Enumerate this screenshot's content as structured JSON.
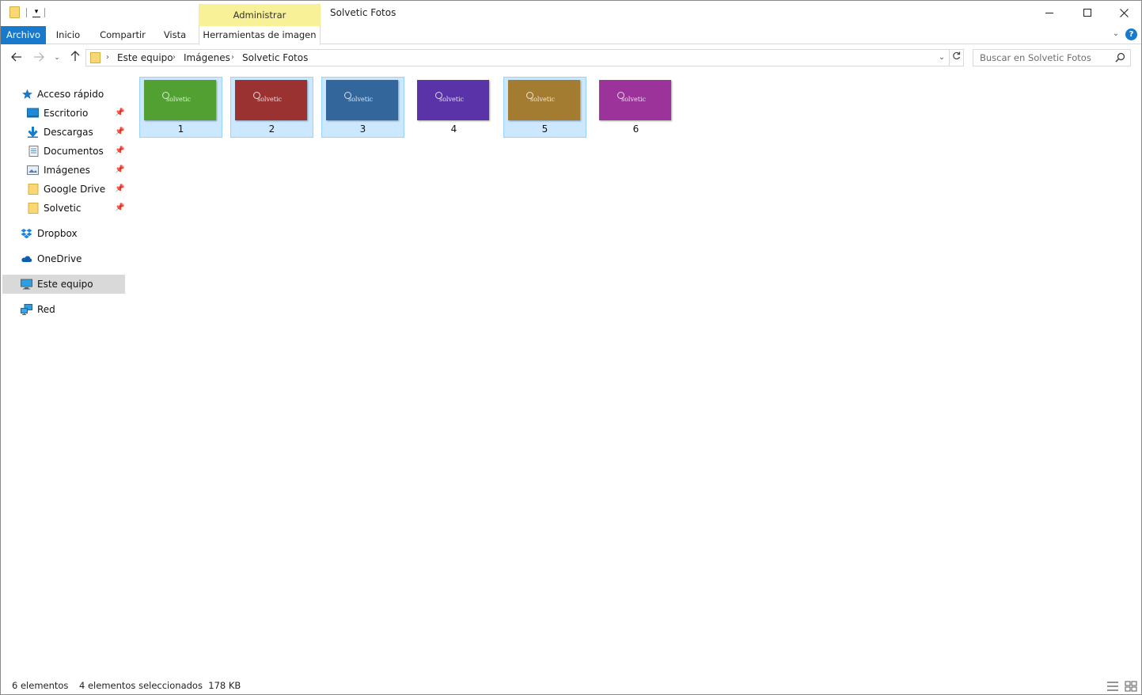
{
  "window": {
    "title": "Solvetic Fotos",
    "context_group": "Administrar"
  },
  "ribbon": {
    "tabs": [
      "Archivo",
      "Inicio",
      "Compartir",
      "Vista",
      "Herramientas de imagen"
    ]
  },
  "address": {
    "breadcrumbs": [
      "Este equipo",
      "Imágenes",
      "Solvetic Fotos"
    ]
  },
  "search": {
    "placeholder": "Buscar en Solvetic Fotos"
  },
  "navpane": {
    "quick_access": "Acceso rápido",
    "pinned": [
      "Escritorio",
      "Descargas",
      "Documentos",
      "Imágenes",
      "Google Drive",
      "Solvetic"
    ],
    "dropbox": "Dropbox",
    "onedrive": "OneDrive",
    "this_pc": "Este equipo",
    "network": "Red"
  },
  "files": [
    {
      "name": "1",
      "color": "#52a031",
      "selected": true
    },
    {
      "name": "2",
      "color": "#9b3232",
      "selected": true
    },
    {
      "name": "3",
      "color": "#33669b",
      "selected": true
    },
    {
      "name": "4",
      "color": "#5b33a8",
      "selected": false
    },
    {
      "name": "5",
      "color": "#a37c31",
      "selected": true
    },
    {
      "name": "6",
      "color": "#9b339b",
      "selected": false
    }
  ],
  "thumbnail_brand": "solvetic",
  "status": {
    "count": "6 elementos",
    "selection": "4 elementos seleccionados  178 KB"
  },
  "colors": {
    "accent": "#1979ca",
    "context_tab": "#f8f198",
    "selection_fill": "#cce8ff",
    "selection_border": "#99d1ff"
  }
}
